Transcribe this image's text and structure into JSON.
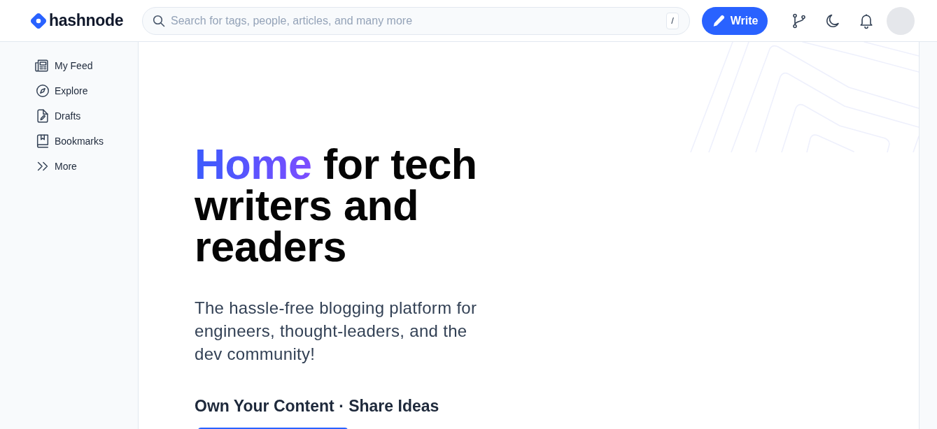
{
  "header": {
    "logo": "hashnode",
    "search": {
      "placeholder": "Search for tags, people, articles, and many more",
      "shortcut": "/"
    },
    "write_button": "Write"
  },
  "sidebar": {
    "items": [
      {
        "label": "My Feed"
      },
      {
        "label": "Explore"
      },
      {
        "label": "Drafts"
      },
      {
        "label": "Bookmarks"
      },
      {
        "label": "More"
      }
    ]
  },
  "hero": {
    "title": "**Home** for tech writers and readers",
    "subtitle": "The hassle-free blogging platform for engineers, thought-leaders, and the dev community!",
    "tagline": "Own Your Content · Share Ideas"
  }
}
